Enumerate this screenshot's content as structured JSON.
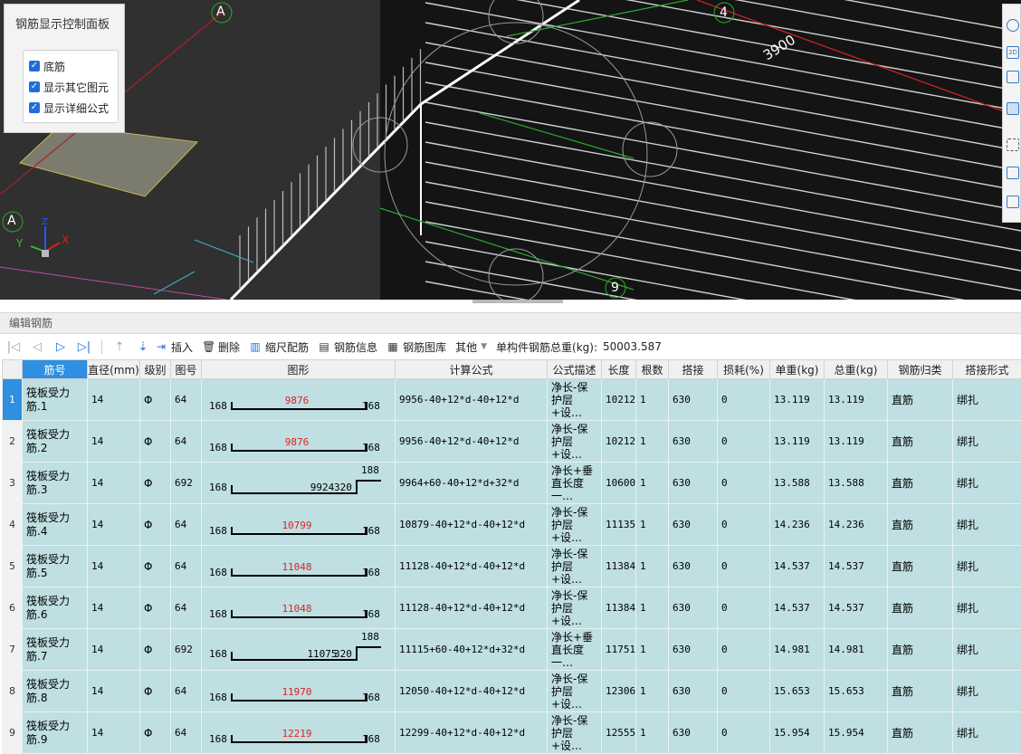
{
  "viewport": {
    "control_panel": {
      "title": "钢筋显示控制面板",
      "options": [
        {
          "label": "底筋",
          "checked": true
        },
        {
          "label": "显示其它图元",
          "checked": true
        },
        {
          "label": "显示详细公式",
          "checked": true
        }
      ]
    },
    "labels": {
      "axis_a_top": "A",
      "axis_a_left": "A",
      "axis_4": "4",
      "axis_9": "9",
      "dimension": "3900",
      "axis_x": "X",
      "axis_y": "Y",
      "axis_z": "Z"
    },
    "side_tools": [
      "sphere-icon",
      "2d-icon",
      "box-icon",
      "cube-icon",
      "select-box-icon",
      "view-cube-icon",
      "list-icon"
    ]
  },
  "editor": {
    "title": "编辑钢筋",
    "toolbar": {
      "insert": "插入",
      "delete": "删除",
      "scale": "缩尺配筋",
      "info": "钢筋信息",
      "library": "钢筋图库",
      "other": "其他",
      "total_label": "单构件钢筋总重(kg):",
      "total_value": "50003.587"
    },
    "columns": [
      "筋号",
      "直径(mm)",
      "级别",
      "图号",
      "图形",
      "计算公式",
      "公式描述",
      "长度",
      "根数",
      "搭接",
      "损耗(%)",
      "单重(kg)",
      "总重(kg)",
      "钢筋归类",
      "搭接形式"
    ],
    "rows": [
      {
        "n": "1",
        "name": "筏板受力筋.1",
        "dia": "14",
        "grade": "Φ",
        "fig": "64",
        "shape": "straight",
        "left": "168",
        "mid": "9876",
        "right": "168",
        "formula": "9956-40+12*d-40+12*d",
        "desc": "净长-保护层+设…",
        "len": "10212",
        "count": "1",
        "lap": "630",
        "loss": "0",
        "unit": "13.119",
        "total": "13.119",
        "cat": "直筋",
        "lapform": "绑扎"
      },
      {
        "n": "2",
        "name": "筏板受力筋.2",
        "dia": "14",
        "grade": "Φ",
        "fig": "64",
        "shape": "straight",
        "left": "168",
        "mid": "9876",
        "right": "168",
        "formula": "9956-40+12*d-40+12*d",
        "desc": "净长-保护层+设…",
        "len": "10212",
        "count": "1",
        "lap": "630",
        "loss": "0",
        "unit": "13.119",
        "total": "13.119",
        "cat": "直筋",
        "lapform": "绑扎"
      },
      {
        "n": "3",
        "name": "筏板受力筋.3",
        "dia": "14",
        "grade": "Φ",
        "fig": "692",
        "shape": "hook",
        "left": "168",
        "mid": "9924",
        "sub": "320",
        "hook": "188",
        "formula": "9964+60-40+12*d+32*d",
        "desc": "净长+垂直长度一…",
        "len": "10600",
        "count": "1",
        "lap": "630",
        "loss": "0",
        "unit": "13.588",
        "total": "13.588",
        "cat": "直筋",
        "lapform": "绑扎"
      },
      {
        "n": "4",
        "name": "筏板受力筋.4",
        "dia": "14",
        "grade": "Φ",
        "fig": "64",
        "shape": "straight",
        "left": "168",
        "mid": "10799",
        "right": "168",
        "formula": "10879-40+12*d-40+12*d",
        "desc": "净长-保护层+设…",
        "len": "11135",
        "count": "1",
        "lap": "630",
        "loss": "0",
        "unit": "14.236",
        "total": "14.236",
        "cat": "直筋",
        "lapform": "绑扎"
      },
      {
        "n": "5",
        "name": "筏板受力筋.5",
        "dia": "14",
        "grade": "Φ",
        "fig": "64",
        "shape": "straight",
        "left": "168",
        "mid": "11048",
        "right": "168",
        "formula": "11128-40+12*d-40+12*d",
        "desc": "净长-保护层+设…",
        "len": "11384",
        "count": "1",
        "lap": "630",
        "loss": "0",
        "unit": "14.537",
        "total": "14.537",
        "cat": "直筋",
        "lapform": "绑扎"
      },
      {
        "n": "6",
        "name": "筏板受力筋.6",
        "dia": "14",
        "grade": "Φ",
        "fig": "64",
        "shape": "straight",
        "left": "168",
        "mid": "11048",
        "right": "168",
        "formula": "11128-40+12*d-40+12*d",
        "desc": "净长-保护层+设…",
        "len": "11384",
        "count": "1",
        "lap": "630",
        "loss": "0",
        "unit": "14.537",
        "total": "14.537",
        "cat": "直筋",
        "lapform": "绑扎"
      },
      {
        "n": "7",
        "name": "筏板受力筋.7",
        "dia": "14",
        "grade": "Φ",
        "fig": "692",
        "shape": "hook",
        "left": "168",
        "mid": "11075",
        "sub": "320",
        "hook": "188",
        "formula": "11115+60-40+12*d+32*d",
        "desc": "净长+垂直长度一…",
        "len": "11751",
        "count": "1",
        "lap": "630",
        "loss": "0",
        "unit": "14.981",
        "total": "14.981",
        "cat": "直筋",
        "lapform": "绑扎"
      },
      {
        "n": "8",
        "name": "筏板受力筋.8",
        "dia": "14",
        "grade": "Φ",
        "fig": "64",
        "shape": "straight",
        "left": "168",
        "mid": "11970",
        "right": "168",
        "formula": "12050-40+12*d-40+12*d",
        "desc": "净长-保护层+设…",
        "len": "12306",
        "count": "1",
        "lap": "630",
        "loss": "0",
        "unit": "15.653",
        "total": "15.653",
        "cat": "直筋",
        "lapform": "绑扎"
      },
      {
        "n": "9",
        "name": "筏板受力筋.9",
        "dia": "14",
        "grade": "Φ",
        "fig": "64",
        "shape": "straight",
        "left": "168",
        "mid": "12219",
        "right": "168",
        "formula": "12299-40+12*d-40+12*d",
        "desc": "净长-保护层+设…",
        "len": "12555",
        "count": "1",
        "lap": "630",
        "loss": "0",
        "unit": "15.954",
        "total": "15.954",
        "cat": "直筋",
        "lapform": "绑扎"
      }
    ]
  }
}
